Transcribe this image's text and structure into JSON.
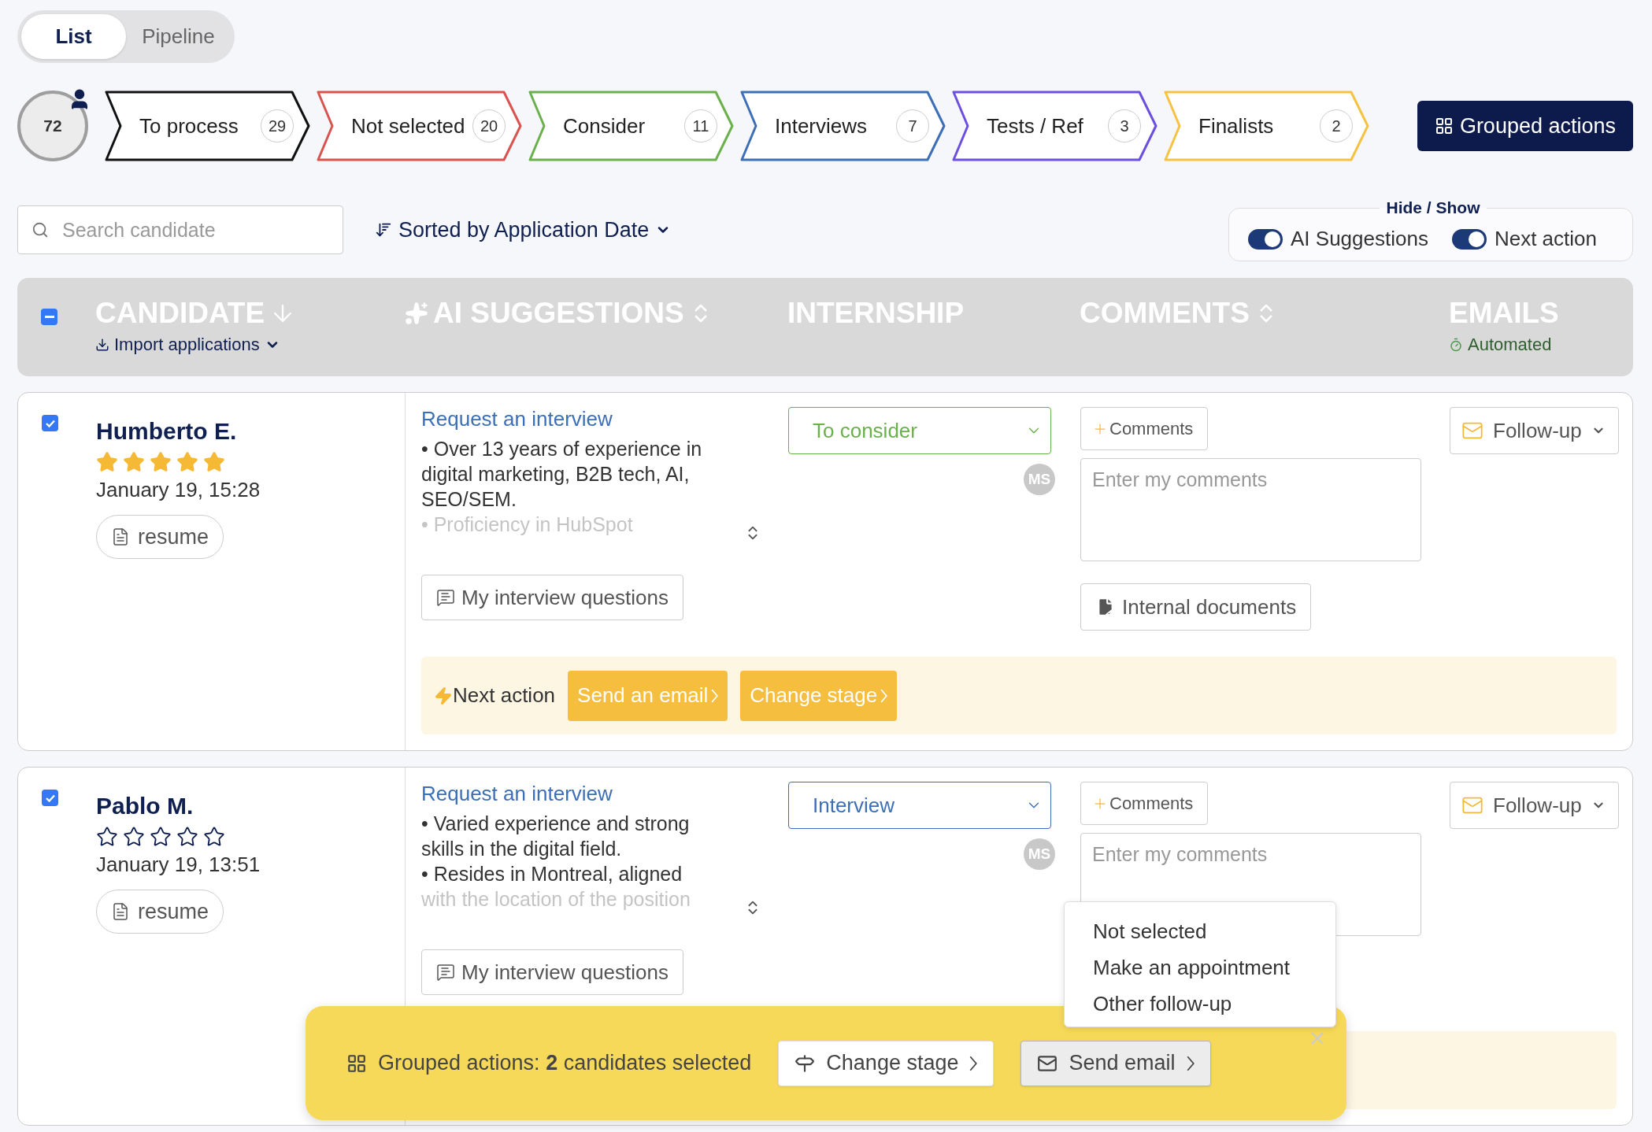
{
  "view_toggle": [
    {
      "label": "List",
      "selected": true
    },
    {
      "label": "Pipeline",
      "selected": false
    }
  ],
  "total_candidates": "72",
  "stages": [
    {
      "label": "To process",
      "count": "29",
      "color": "#111111"
    },
    {
      "label": "Not selected",
      "count": "20",
      "color": "#d9534f"
    },
    {
      "label": "Consider",
      "count": "11",
      "color": "#6ab04c"
    },
    {
      "label": "Interviews",
      "count": "7",
      "color": "#3d6fb6"
    },
    {
      "label": "Tests / Ref",
      "count": "3",
      "color": "#6c4fe0"
    },
    {
      "label": "Finalists",
      "count": "2",
      "color": "#f5c242"
    }
  ],
  "grouped_actions_button": "Grouped actions",
  "search": {
    "placeholder": "Search candidate"
  },
  "sort": {
    "label": "Sorted by Application Date"
  },
  "visibility": {
    "title": "Hide / Show",
    "toggles": [
      {
        "label": "AI Suggestions",
        "on": true
      },
      {
        "label": "Next action",
        "on": true
      }
    ]
  },
  "table": {
    "select_all": {
      "indeterminate": true
    },
    "columns": [
      {
        "title": "CANDIDATE",
        "kind": "plain",
        "sortable": true,
        "sorted": true,
        "subtitle": {
          "kind": "import",
          "label": "Import applications"
        }
      },
      {
        "title": "AI SUGGESTIONS",
        "kind": "ai",
        "sortable": true,
        "sorted": false
      },
      {
        "title": "INTERNSHIP",
        "kind": "plain",
        "sortable": false,
        "sorted": false
      },
      {
        "title": "COMMENTS",
        "kind": "plain",
        "sortable": true,
        "sorted": false
      },
      {
        "title": "EMAILS",
        "kind": "plain",
        "sortable": false,
        "sorted": false,
        "subtitle": {
          "kind": "automation",
          "label": "Automated"
        }
      }
    ],
    "rows": [
      {
        "checked": true,
        "name": "Humberto E.",
        "stars": 5,
        "date": "January 19, 15:28",
        "resume": "resume",
        "suggestion_link": "Request an interview",
        "suggestion_lines": [
          {
            "text": "• Over 13 years of experience in digital marketing, B2B tech, AI, SEO/SEM.",
            "faded": false
          },
          {
            "text": "• Proficiency in HubSpot",
            "faded": true
          }
        ],
        "questions_button": "My interview questions",
        "stage": {
          "label": "To consider",
          "color": "#6ab04c"
        },
        "assignee": "MS",
        "comments_button": "Comments",
        "comments": {
          "placeholder": "Enter my comments"
        },
        "documents_button": "Internal documents",
        "email_button": "Follow-up",
        "next_action": {
          "label": "Next action",
          "buttons": [
            "Send an email",
            "Change stage"
          ]
        }
      },
      {
        "checked": true,
        "name": "Pablo M.",
        "stars": 0,
        "date": "January 19, 13:51",
        "resume": "resume",
        "suggestion_link": "Request an interview",
        "suggestion_lines": [
          {
            "text": "• Varied experience and strong skills in the digital field.",
            "faded": false
          },
          {
            "text": "• Resides in Montreal, aligned",
            "faded": false
          },
          {
            "text": "with the location of the position",
            "faded": true
          }
        ],
        "questions_button": "My interview questions",
        "stage": {
          "label": "Interview",
          "color": "#3d6fb6"
        },
        "assignee": "MS",
        "comments_button": "Comments",
        "comments": {
          "placeholder": "Enter my comments"
        },
        "email_button": "Follow-up"
      }
    ]
  },
  "grouped_bar": {
    "text": "Grouped actions: **2** candidates selected",
    "buttons": [
      {
        "kind": "stage",
        "label": "Change stage",
        "open": false
      },
      {
        "kind": "email",
        "label": "Send email",
        "open": true
      }
    ]
  },
  "email_menu": [
    "Not selected",
    "Make an appointment",
    "Other follow-up"
  ]
}
